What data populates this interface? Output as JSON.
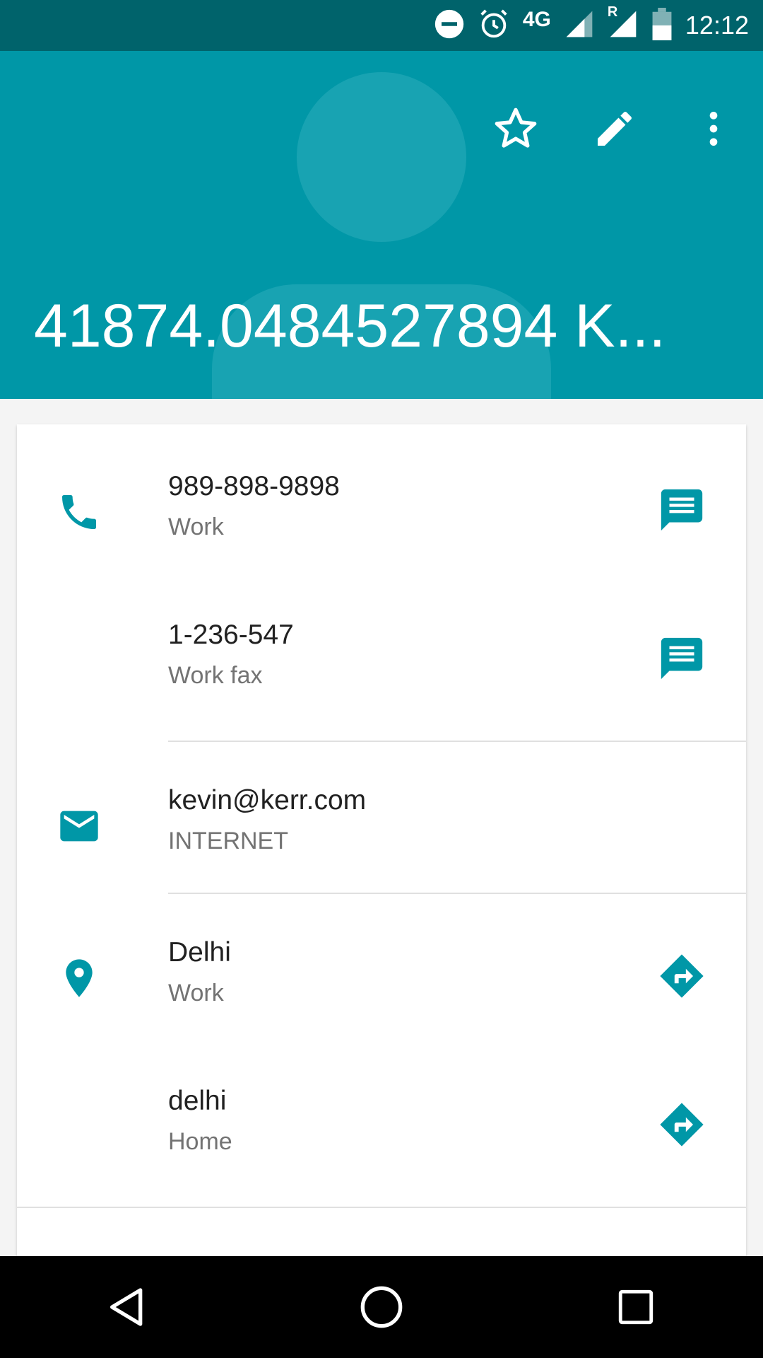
{
  "status_bar": {
    "time": "12:12",
    "network": "4G",
    "roaming": "R",
    "icons": [
      "do-not-disturb-icon",
      "alarm-icon",
      "signal-icon",
      "roaming-signal-icon",
      "battery-icon"
    ]
  },
  "header": {
    "contact_name": "41874.0484527894 K...",
    "actions": [
      "star-icon",
      "edit-icon",
      "more-vert-icon"
    ]
  },
  "contact": {
    "phones": [
      {
        "number": "989-898-9898",
        "type": "Work"
      },
      {
        "number": "1-236-547",
        "type": "Work fax"
      }
    ],
    "email": {
      "address": "kevin@kerr.com",
      "type": "INTERNET"
    },
    "addresses": [
      {
        "address": "Delhi",
        "type": "Work"
      },
      {
        "address": "delhi",
        "type": "Home"
      }
    ]
  },
  "colors": {
    "status_bar": "#00636b",
    "header": "#0097a7",
    "accent": "#0097a7",
    "primary_text": "#212121",
    "secondary_text": "#737373"
  },
  "nav_bar": [
    "back-icon",
    "home-icon",
    "recents-icon"
  ]
}
